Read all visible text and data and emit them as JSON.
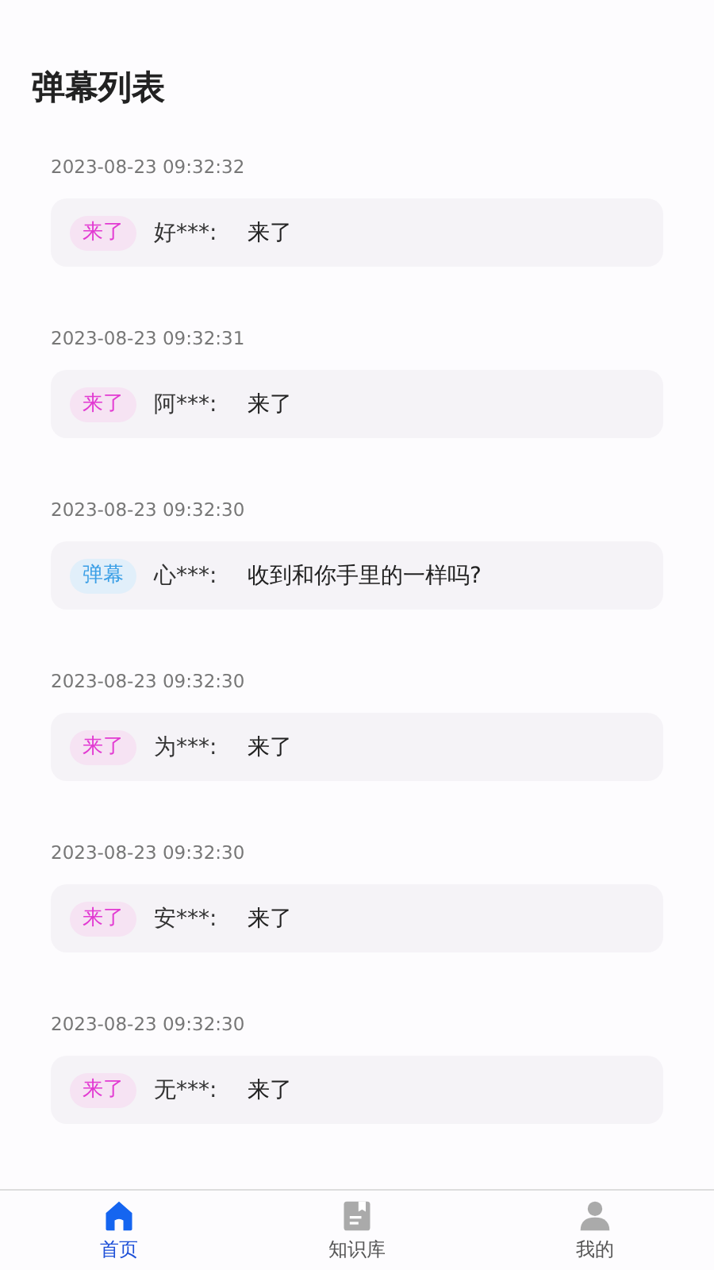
{
  "title": "弹幕列表",
  "entries": [
    {
      "time": "2023-08-23 09:32:32",
      "tag": "来了",
      "kind": "arrival",
      "user": "好***:",
      "message": "来了"
    },
    {
      "time": "2023-08-23 09:32:31",
      "tag": "来了",
      "kind": "arrival",
      "user": "阿***:",
      "message": "来了"
    },
    {
      "time": "2023-08-23 09:32:30",
      "tag": "弹幕",
      "kind": "comment",
      "user": "心***:",
      "message": "收到和你手里的一样吗?"
    },
    {
      "time": "2023-08-23 09:32:30",
      "tag": "来了",
      "kind": "arrival",
      "user": "为***:",
      "message": "来了"
    },
    {
      "time": "2023-08-23 09:32:30",
      "tag": "来了",
      "kind": "arrival",
      "user": "安***:",
      "message": "来了"
    },
    {
      "time": "2023-08-23 09:32:30",
      "tag": "来了",
      "kind": "arrival",
      "user": "无***:",
      "message": "来了"
    }
  ],
  "tabs": [
    {
      "label": "首页",
      "kind": "home",
      "selected": true
    },
    {
      "label": "知识库",
      "kind": "book",
      "selected": false
    },
    {
      "label": "我的",
      "kind": "person",
      "selected": false
    }
  ]
}
